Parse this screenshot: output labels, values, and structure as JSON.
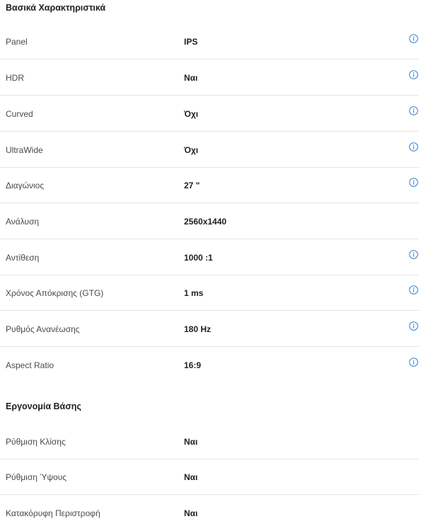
{
  "colors": {
    "info_icon": "#2f7fd6",
    "divider": "#e4e4e4"
  },
  "sections": [
    {
      "title": "Βασικά Χαρακτηριστικά",
      "rows": [
        {
          "label": "Panel",
          "value": "IPS",
          "icon": "info-icon"
        },
        {
          "label": "HDR",
          "value": "Ναι",
          "icon": "info-icon"
        },
        {
          "label": "Curved",
          "value": "Όχι",
          "icon": "info-icon"
        },
        {
          "label": "UltraWide",
          "value": "Όχι",
          "icon": "info-icon"
        },
        {
          "label": "Διαγώνιος",
          "value": "27 \"",
          "icon": "info-icon"
        },
        {
          "label": "Ανάλυση",
          "value": "2560x1440",
          "icon": ""
        },
        {
          "label": "Αντίθεση",
          "value": "1000 :1",
          "icon": "info-icon"
        },
        {
          "label": "Χρόνος Απόκρισης (GTG)",
          "value": "1 ms",
          "icon": "info-icon"
        },
        {
          "label": "Ρυθμός Ανανέωσης",
          "value": "180 Hz",
          "icon": "info-icon"
        },
        {
          "label": "Aspect Ratio",
          "value": "16:9",
          "icon": "info-icon"
        }
      ]
    },
    {
      "title": "Εργονομία Βάσης",
      "rows": [
        {
          "label": "Ρύθμιση Κλίσης",
          "value": "Ναι",
          "icon": ""
        },
        {
          "label": "Ρύθμιση Ύψους",
          "value": "Ναι",
          "icon": ""
        },
        {
          "label": "Κατακόρυφη Περιστροφή",
          "value": "Ναι",
          "icon": ""
        }
      ]
    }
  ]
}
